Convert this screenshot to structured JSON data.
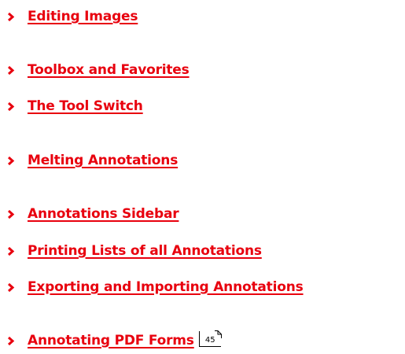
{
  "toc": {
    "items": [
      {
        "label": "Editing Images"
      },
      {
        "label": "Toolbox and Favorites"
      },
      {
        "label": "The Tool Switch"
      },
      {
        "label": "Melting Annotations"
      },
      {
        "label": "Annotations Sidebar"
      },
      {
        "label": "Printing Lists of all Annotations"
      },
      {
        "label": "Exporting and Importing Annotations"
      },
      {
        "label": "Annotating PDF Forms",
        "page_ref": "45"
      }
    ],
    "bullet_icon": "chevron-right-icon",
    "link_color": "#e8000e"
  }
}
